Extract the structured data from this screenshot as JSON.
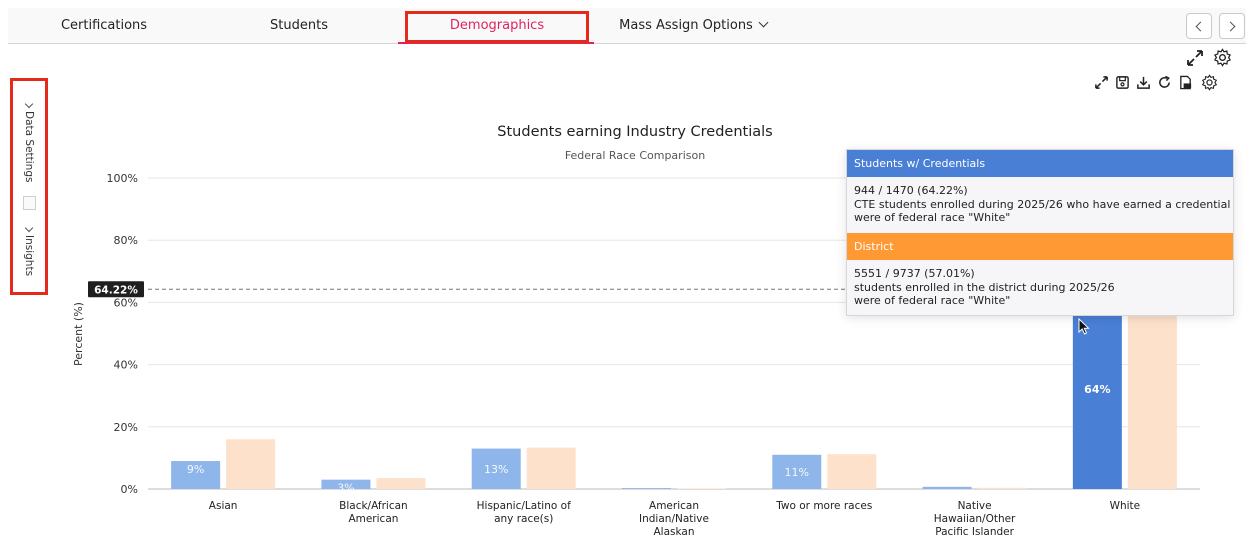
{
  "tabs": [
    {
      "label": "Certifications",
      "active": false
    },
    {
      "label": "Students",
      "active": false
    },
    {
      "label": "Demographics",
      "active": true
    },
    {
      "label": "Mass Assign Options",
      "active": false
    }
  ],
  "side_panel": {
    "data_settings_label": "Data Settings",
    "insights_label": "Insights"
  },
  "colors": {
    "series_primary": "#4a7fd6",
    "series_primary_faded": "#8fb6ea",
    "series_district_faded": "#fde1cb",
    "series_district": "#ff9933",
    "accent_tab": "#e0245e",
    "highlight_box": "#e4291d"
  },
  "toolbar_icons": [
    "expand-icon",
    "save-icon",
    "download-icon",
    "refresh-icon",
    "pdf-icon",
    "gear-icon"
  ],
  "reference_line_label": "64.22%",
  "chart_data": {
    "type": "bar",
    "title": "Students earning Industry Credentials",
    "subtitle": "Federal Race Comparison",
    "ylabel": "Percent (%)",
    "xlabel": "",
    "ylim": [
      0,
      100
    ],
    "yticks": [
      "0%",
      "20%",
      "40%",
      "60%",
      "80%",
      "100%"
    ],
    "ytick_values": [
      0,
      20,
      40,
      60,
      80,
      100
    ],
    "grid": true,
    "categories": [
      [
        "Asian"
      ],
      [
        "Black/African",
        "American"
      ],
      [
        "Hispanic/Latino of",
        "any race(s)"
      ],
      [
        "American",
        "Indian/Native",
        "Alaskan"
      ],
      [
        "Two or more races"
      ],
      [
        "Native",
        "Hawaiian/Other",
        "Pacific Islander"
      ],
      [
        "White"
      ]
    ],
    "series": [
      {
        "name": "Students w/ Credentials",
        "values": [
          9,
          3,
          13,
          0.3,
          11,
          0.7,
          64.22
        ],
        "labels": [
          "9%",
          "3%",
          "13%",
          "",
          "11%",
          "",
          "64%"
        ]
      },
      {
        "name": "District",
        "values": [
          16,
          3.5,
          13.3,
          0.2,
          11.2,
          0.4,
          57.01
        ],
        "labels": [
          "",
          "",
          "",
          "",
          "",
          "",
          ""
        ]
      }
    ],
    "reference_line": 64.22,
    "highlighted_index": 6
  },
  "tooltip": {
    "series1_title": "Students w/ Credentials",
    "series1_line1": "944 / 1470 (64.22%)",
    "series1_line2": "CTE students enrolled during 2025/26 who have earned a credential",
    "series1_line3": "were of federal race \"White\"",
    "series2_title": "District",
    "series2_line1": "5551 / 9737 (57.01%)",
    "series2_line2": "students enrolled in the district during 2025/26",
    "series2_line3": "were of federal race \"White\""
  }
}
